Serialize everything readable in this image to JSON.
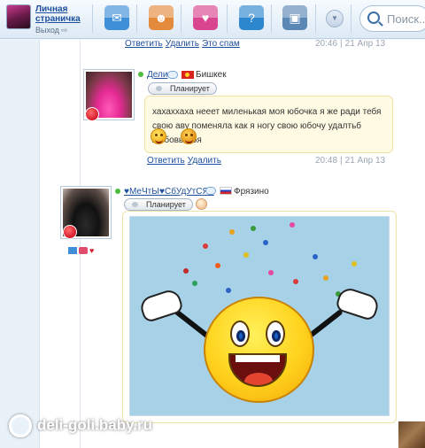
{
  "header": {
    "profile_link": "Личная страничка",
    "logout_label": "Выход",
    "nav_icons": [
      "mail-icon",
      "doll-icon",
      "gifts-icon",
      "chat-icon",
      "photos-icon"
    ],
    "search_placeholder": "Поиск..."
  },
  "post0": {
    "reply": "Ответить",
    "delete": "Удалить",
    "extra": "Это спам",
    "time": "20:46",
    "date": "21 Апр 13"
  },
  "post1": {
    "username": "Дели",
    "city": "Бишкек",
    "status": "Планирует",
    "text": "хахаххаха нееет миленькая моя юбочка я же ради тебя свою аву поменяла как я ногу свою юбочу удалтьб любовь моя",
    "reply": "Ответить",
    "delete": "Удалить",
    "time": "20:48",
    "date": "21 Апр 13"
  },
  "post2": {
    "username": "♥МеЧтЫ♥СбУдУтСЯ♥",
    "city": "Фрязино",
    "status": "Планирует"
  },
  "watermark": "deli-goli.baby.ru",
  "colors": {
    "link": "#1d4f9c",
    "online": "#4cbc3d",
    "bubble": "#fffae3"
  }
}
